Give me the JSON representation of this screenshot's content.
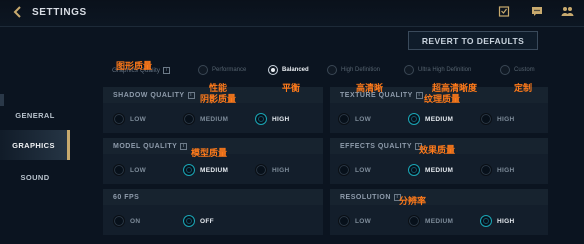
{
  "header": {
    "title": "SETTINGS",
    "back_icon": "chevron-left-icon",
    "icons": [
      "mission-icon",
      "chat-icon",
      "friends-icon"
    ]
  },
  "revert": {
    "label": "REVERT TO DEFAULTS"
  },
  "sidebar": {
    "items": [
      {
        "label": "GENERAL",
        "active": false
      },
      {
        "label": "GRAPHICS",
        "active": true
      },
      {
        "label": "SOUND",
        "active": false
      }
    ]
  },
  "graphics_quality": {
    "label": "Graphics Quality",
    "options": [
      "Performance",
      "Balanced",
      "High Definition",
      "Ultra High Definition",
      "Custom"
    ],
    "selected": "Balanced"
  },
  "panels": {
    "shadow": {
      "title": "SHADOW QUALITY",
      "options": [
        "LOW",
        "MEDIUM",
        "HIGH"
      ],
      "selected": "HIGH"
    },
    "texture": {
      "title": "TEXTURE QUALITY",
      "options": [
        "LOW",
        "MEDIUM",
        "HIGH"
      ],
      "selected": "MEDIUM"
    },
    "model": {
      "title": "MODEL QUALITY",
      "options": [
        "LOW",
        "MEDIUM",
        "HIGH"
      ],
      "selected": "MEDIUM"
    },
    "effects": {
      "title": "EFFECTS QUALITY",
      "options": [
        "LOW",
        "MEDIUM",
        "HIGH"
      ],
      "selected": "MEDIUM"
    },
    "fps": {
      "title": "60 FPS",
      "options": [
        "ON",
        "OFF"
      ],
      "selected": "OFF"
    },
    "resolution": {
      "title": "RESOLUTION",
      "options": [
        "LOW",
        "MEDIUM",
        "HIGH"
      ],
      "selected": "HIGH"
    }
  },
  "annotations": {
    "graphics_quality": "图形质量",
    "performance": "性能",
    "balanced": "平衡",
    "high_definition": "高清晰",
    "ultra_high_definition": "超高清晰度",
    "custom": "定制",
    "shadow": "阴影质量",
    "texture": "纹理质量",
    "model": "模型质量",
    "effects": "效果质量",
    "resolution": "分辨率"
  },
  "colors": {
    "accent_gold": "#c8aa6e",
    "annotation_orange": "#ff7a1a",
    "selected_teal": "#1aa5b4",
    "background": "#0b1420"
  }
}
